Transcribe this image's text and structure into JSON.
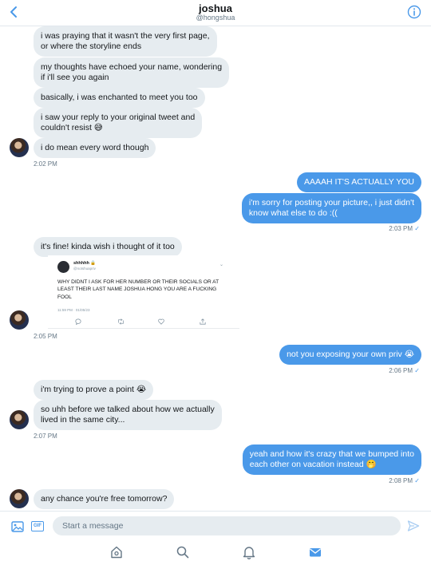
{
  "header": {
    "title": "joshua",
    "handle": "@hongshua"
  },
  "messages": [
    {
      "text": "i was praying that it wasn't the very first page,\nor where the storyline ends"
    },
    {
      "text": "my thoughts have echoed your name, wondering\nif i'll see you again"
    },
    {
      "text": "basically, i was enchanted to meet you too"
    },
    {
      "text": "i saw your reply to your original tweet and\ncouldn't resist 😅"
    },
    {
      "text": "i do mean every word though"
    },
    {
      "text": "AAAAH IT'S ACTUALLY YOU"
    },
    {
      "text": "i'm sorry for posting your picture,, i just didn't\nknow what else to do :(("
    },
    {
      "text": "it's fine! kinda wish i thought of it too"
    },
    {
      "text": "not you exposing your own priv 😭"
    },
    {
      "text": "i'm trying to prove a point 😭"
    },
    {
      "text": "so uhh before we talked about how we actually\nlived in the same city..."
    },
    {
      "text": "yeah and how it's crazy that we bumped into\neach other on vacation instead 🤭"
    },
    {
      "text": "any chance you're free tomorrow?"
    }
  ],
  "timestamps": [
    "2:02 PM",
    "2:03 PM",
    "2:05 PM",
    "2:06 PM",
    "2:07 PM",
    "2:08 PM"
  ],
  "read_mark": "✓",
  "embedded_tweet": {
    "name": "shhhhh 🔒",
    "handle": "@notshuapriv",
    "text": "WHY DIDNT I ASK FOR HER NUMBER OR THEIR SOCIALS OR AT LEAST THEIR LAST NAME JOSHUA HONG YOU ARE A FUCKING FOOL",
    "meta": "11:59 PM · 01/05/23",
    "actions": [
      "reply-icon",
      "retweet-icon",
      "like-icon",
      "share-icon"
    ]
  },
  "composer": {
    "placeholder": "Start a message",
    "gif_label": "GIF"
  },
  "bottom_nav": [
    "home-icon",
    "search-icon",
    "notifications-icon",
    "messages-icon"
  ],
  "colors": {
    "accent": "#4a99e9",
    "incoming_bubble": "#e6ecf0",
    "muted_text": "#657786"
  }
}
